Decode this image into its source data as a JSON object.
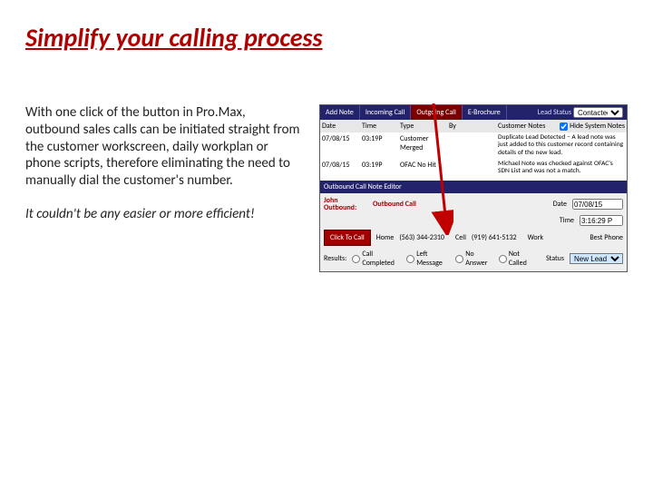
{
  "title": "Simplify your calling process",
  "paragraph": "With one click of the button in Pro.Max, outbound sales calls can be initiated straight from the customer workscreen, daily workplan or phone scripts, therefore eliminating the need to manually dial the customer's number.",
  "tagline": "It couldn't be any easier or more efficient!",
  "app": {
    "tabs": {
      "add_note": "Add Note",
      "incoming": "Incoming Call",
      "outgoing": "Outgoing Call",
      "ebrochure": "E-Brochure"
    },
    "lead_status_label": "Lead Status",
    "lead_status_value": "Contacted",
    "columns": {
      "date": "Date",
      "time": "Time",
      "type": "Type",
      "by": "By",
      "notes": "Customer Notes"
    },
    "hide_system_label": "Hide System Notes",
    "hide_system_checked": true,
    "rows": [
      {
        "date": "07/08/15",
        "time": "03:19P",
        "type": "Customer Merged",
        "by": "",
        "notes": "Duplicate Lead Detected – A lead note was just added to this customer record containing details of the new lead."
      },
      {
        "date": "07/08/15",
        "time": "03:19P",
        "type": "OFAC No Hit",
        "by": "",
        "notes": "Michael Note was checked against OFAC's SDN List and was not a match."
      }
    ],
    "editor_title": "Outbound Call Note Editor",
    "editor": {
      "person_label": "John Outbound:",
      "call_type": "Outbound Call",
      "date_label": "Date",
      "date_value": "07/08/15",
      "time_label": "Time",
      "time_value": "3:16:29 P",
      "click_to_call": "Click To Call",
      "home_label": "Home",
      "home_value": "(563) 344-2310",
      "cell_label": "Cell",
      "cell_value": "(919) 641-5132",
      "work_label": "Work",
      "best_phone_label": "Best Phone",
      "results_label": "Results:",
      "results": {
        "contacted": "Call Completed",
        "left_msg": "Left Message",
        "no_answer": "No Answer",
        "not_called": "Not Called"
      },
      "status_label": "Status",
      "status_value": "New Lead"
    }
  }
}
